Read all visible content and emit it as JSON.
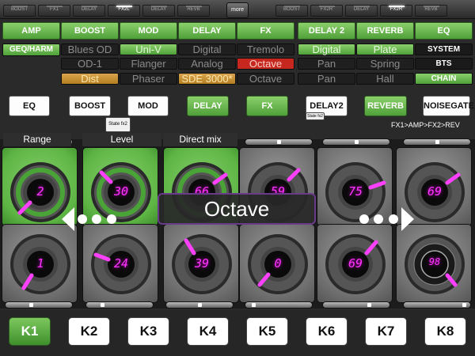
{
  "top_tabs": [
    {
      "label": "BOOST",
      "active": false
    },
    {
      "label": "FX1",
      "active": false
    },
    {
      "label": "DELAY",
      "active": false
    },
    {
      "label": "FX2L",
      "active": true
    },
    {
      "label": "DELAY",
      "active": false
    },
    {
      "label": "REVB",
      "active": false
    },
    {
      "label": "BOOST",
      "active": false
    },
    {
      "label": "FX2R",
      "active": false
    },
    {
      "label": "DELAY",
      "active": false
    },
    {
      "label": "FX2R",
      "active": true
    },
    {
      "label": "REVB",
      "active": false
    }
  ],
  "more_label": "more",
  "categories": [
    "AMP",
    "BOOST",
    "MOD",
    "DELAY",
    "FX",
    "DELAY 2",
    "REVERB",
    "EQ"
  ],
  "geq_label": "GEQ/HARM",
  "system_label": "SYSTEM",
  "bts_label": "BTS",
  "chain_label": "CHAIN",
  "fx_rows": [
    [
      "Blues OD",
      "Uni-V",
      "Digital",
      "Tremolo",
      "Digital",
      "Plate"
    ],
    [
      "OD-1",
      "Flanger",
      "Analog",
      "Octave",
      "Pan",
      "Spring"
    ],
    [
      "Dist",
      "Phaser",
      "SDE 3000*",
      "Octave",
      "Pan",
      "Hall"
    ]
  ],
  "buttons": [
    {
      "label": "EQ",
      "active": false
    },
    {
      "label": "BOOST",
      "active": false
    },
    {
      "label": "MOD",
      "active": false
    },
    {
      "label": "DELAY",
      "active": true
    },
    {
      "label": "FX",
      "active": true
    },
    {
      "label": "DELAY2",
      "active": false
    },
    {
      "label": "REVERB",
      "active": true
    },
    {
      "label": "NOISEGATE",
      "active": false
    }
  ],
  "state_tag_1": "State fx2",
  "state_tag_2": "State fx2",
  "chain_text": "FX1>AMP>FX2>REV",
  "param_labels": [
    "Range",
    "Level",
    "Direct mix"
  ],
  "knobs_top": [
    "2",
    "30",
    "66",
    "59",
    "75",
    "69"
  ],
  "knobs_bottom": [
    "1",
    "24",
    "39",
    "0",
    "69",
    "98"
  ],
  "overlay_label": "Octave",
  "k_buttons": [
    "K1",
    "K2",
    "K3",
    "K4",
    "K5",
    "K6",
    "K7",
    "K8"
  ],
  "k_active": "K1",
  "colors": {
    "accent_green": "#5db544",
    "knob_value": "#ff35ff",
    "active_red": "#c6271f",
    "active_orange": "#b47d20"
  }
}
